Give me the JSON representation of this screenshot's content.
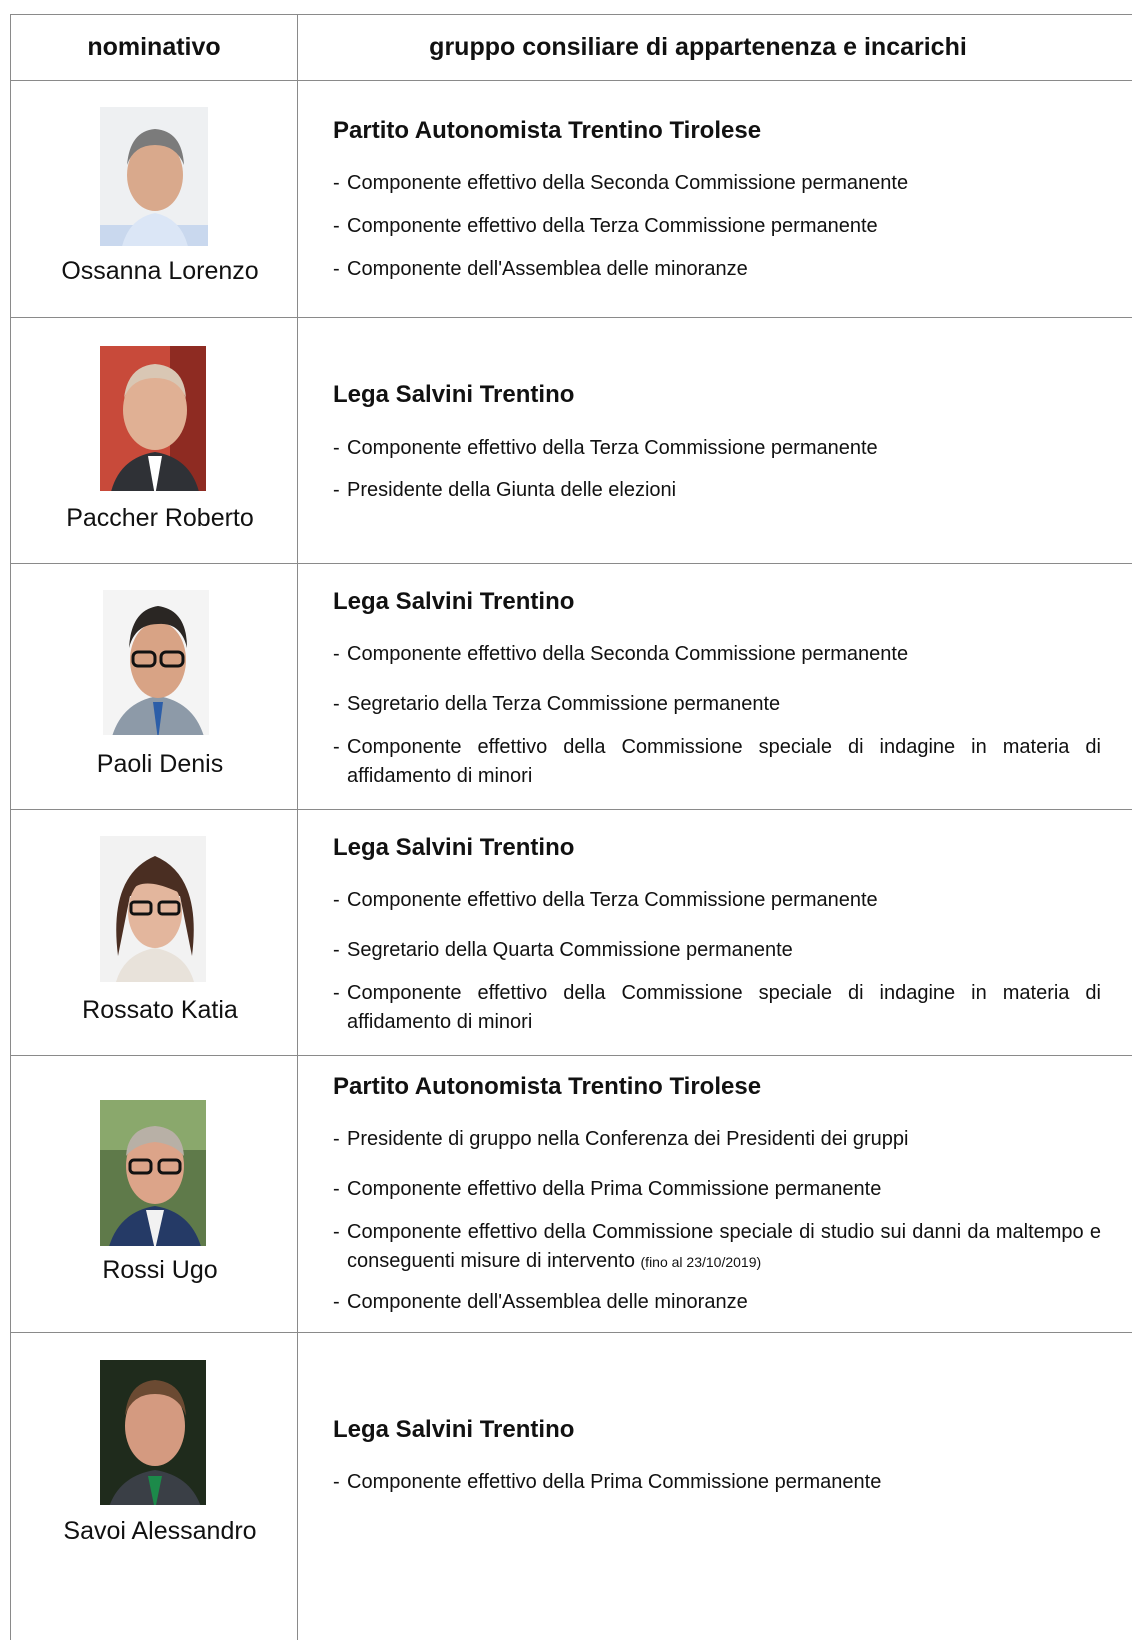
{
  "header": {
    "col1": "nominativo",
    "col2": "gruppo consiliare di appartenenza e incarichi"
  },
  "rows": [
    {
      "name": "Ossanna Lorenzo",
      "photo": "portrait-photo",
      "party": "Partito Autonomista Trentino Tirolese",
      "items": [
        "Componente effettivo della Seconda Commissione permanente",
        "Componente effettivo della Terza Commissione permanente",
        "Componente dell'Assemblea delle minoranze"
      ]
    },
    {
      "name": "Paccher Roberto",
      "photo": "portrait-photo",
      "party": "Lega Salvini Trentino",
      "items": [
        "Componente effettivo della Terza Commissione permanente",
        "Presidente della Giunta delle elezioni"
      ]
    },
    {
      "name": "Paoli Denis",
      "photo": "portrait-photo",
      "party": "Lega Salvini Trentino",
      "items": [
        "Componente effettivo della Seconda Commissione permanente",
        "Segretario della Terza Commissione permanente",
        "Componente effettivo della Commissione speciale di indagine in materia di affidamento di minori"
      ]
    },
    {
      "name": "Rossato Katia",
      "photo": "portrait-photo",
      "party": "Lega Salvini Trentino",
      "items": [
        "Componente effettivo della Terza Commissione permanente",
        "Segretario della Quarta Commissione permanente",
        "Componente effettivo della Commissione speciale di indagine in materia di affidamento di minori"
      ]
    },
    {
      "name": "Rossi Ugo",
      "photo": "portrait-photo",
      "party": "Partito Autonomista Trentino Tirolese",
      "items": [
        "Presidente di gruppo nella Conferenza dei Presidenti dei gruppi",
        "Componente effettivo della Prima Commissione permanente",
        "Componente effettivo della Commissione speciale di studio sui danni da maltempo e conseguenti misure di intervento",
        "Componente dell'Assemblea delle minoranze"
      ],
      "note": "(fino al 23/10/2019)"
    },
    {
      "name": "Savoi Alessandro",
      "photo": "portrait-photo",
      "party": "Lega Salvini Trentino",
      "items": [
        "Componente effettivo della Prima Commissione permanente"
      ]
    }
  ]
}
